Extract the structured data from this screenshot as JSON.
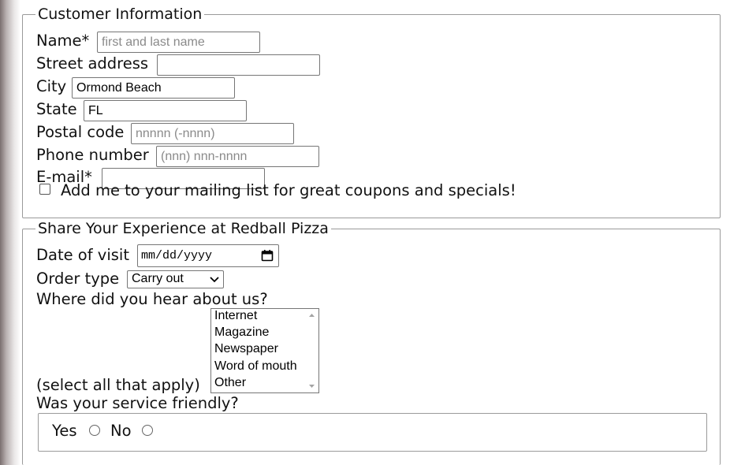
{
  "customer_info": {
    "legend": "Customer Information",
    "name": {
      "label": "Name*",
      "value": "",
      "placeholder": "first and last name"
    },
    "street": {
      "label": "Street address",
      "value": "",
      "placeholder": ""
    },
    "city": {
      "label": "City",
      "value": "Ormond Beach",
      "placeholder": ""
    },
    "state": {
      "label": "State",
      "value": "FL",
      "placeholder": ""
    },
    "postal": {
      "label": "Postal code",
      "value": "",
      "placeholder": "nnnnn (-nnnn)"
    },
    "phone": {
      "label": "Phone number",
      "value": "",
      "placeholder": "(nnn) nnn-nnnn"
    },
    "email": {
      "label": "E-mail*",
      "value": "",
      "placeholder": ""
    },
    "mailing_list": {
      "label": "Add me to your mailing list for great coupons and specials!",
      "checked": false
    }
  },
  "experience": {
    "legend": "Share Your Experience at Redball Pizza",
    "date": {
      "label": "Date of visit",
      "value": "mm/dd/yyyy",
      "icon": "calendar-icon"
    },
    "order_type": {
      "label": "Order type",
      "selected": "Carry out",
      "icon": "chevron-down-icon"
    },
    "hear_about": {
      "label": "Where did you hear about us?",
      "hint": "(select all that apply)",
      "options": [
        "Internet",
        "Magazine",
        "Newspaper",
        "Word of mouth",
        "Other"
      ]
    },
    "friendly": {
      "label": "Was your service friendly?",
      "options": [
        "Yes",
        "No"
      ],
      "selected": null
    }
  }
}
